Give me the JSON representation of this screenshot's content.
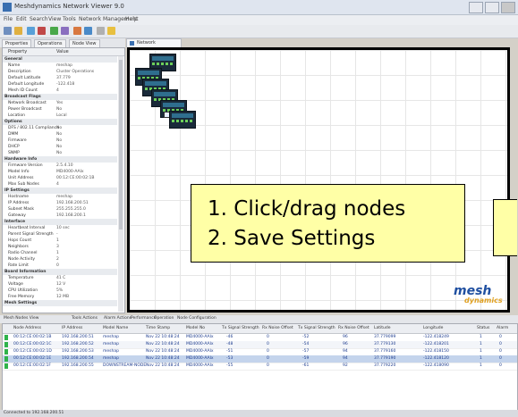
{
  "window": {
    "title": "Meshdynamics Network Viewer 9.0"
  },
  "menu": [
    "File",
    "Edit",
    "Search",
    "View",
    "Tools",
    "Network Management",
    "Help"
  ],
  "left_tabs": [
    "Properties",
    "Operations",
    "Node View"
  ],
  "properties": {
    "header": [
      "Property",
      "Value"
    ],
    "rows": [
      {
        "k": "General",
        "v": "",
        "section": true
      },
      {
        "k": "Name",
        "v": "meshap"
      },
      {
        "k": "Description",
        "v": "Cluster Operations"
      },
      {
        "k": "Default Latitude",
        "v": "37.779"
      },
      {
        "k": "Default Longitude",
        "v": "-122.418"
      },
      {
        "k": "Mesh ID Count",
        "v": "4"
      },
      {
        "k": "Broadcast Flags",
        "v": "",
        "section": true
      },
      {
        "k": "Network Broadcast",
        "v": "Yes"
      },
      {
        "k": "Power Broadcast",
        "v": "No"
      },
      {
        "k": "Location",
        "v": "Local"
      },
      {
        "k": "Options",
        "v": "",
        "section": true
      },
      {
        "k": "DFS / 802.11 Compliance",
        "v": "No"
      },
      {
        "k": "DMM",
        "v": "No"
      },
      {
        "k": "Firmware",
        "v": "No"
      },
      {
        "k": "DHCP",
        "v": "No"
      },
      {
        "k": "SNMP",
        "v": "No"
      },
      {
        "k": "Hardware Info",
        "v": "",
        "section": true
      },
      {
        "k": "Firmware Version",
        "v": "2.5.4.10"
      },
      {
        "k": "Model Info",
        "v": "MD4000-AAIx"
      },
      {
        "k": "Unit Address",
        "v": "00:12:CE:00:02:1B"
      },
      {
        "k": "Max Sub Nodes",
        "v": "4"
      },
      {
        "k": "IP Settings",
        "v": "",
        "section": true
      },
      {
        "k": "Hostname",
        "v": "meshap"
      },
      {
        "k": "IP Address",
        "v": "192.168.200.51"
      },
      {
        "k": "Subnet Mask",
        "v": "255.255.255.0"
      },
      {
        "k": "Gateway",
        "v": "192.168.200.1"
      },
      {
        "k": "Interface",
        "v": "",
        "section": true
      },
      {
        "k": "Heartbeat Interval",
        "v": "10 sec"
      },
      {
        "k": "Parent Signal Strength",
        "v": "-"
      },
      {
        "k": "Hops Count",
        "v": "1"
      },
      {
        "k": "Neighbors",
        "v": "3"
      },
      {
        "k": "Radio Channel",
        "v": "1"
      },
      {
        "k": "Node Activity",
        "v": "2"
      },
      {
        "k": "Rate Limit",
        "v": "0"
      },
      {
        "k": "Board Information",
        "v": "",
        "section": true
      },
      {
        "k": "Temperature",
        "v": "41 C"
      },
      {
        "k": "Voltage",
        "v": "12 V"
      },
      {
        "k": "CPU Utilization",
        "v": "5%"
      },
      {
        "k": "Free Memory",
        "v": "12 MB"
      },
      {
        "k": "Mesh Settings",
        "v": "",
        "section": true
      }
    ]
  },
  "main_tab": "Network",
  "callout": {
    "line1": "1. Click/drag nodes",
    "line2": "2. Save Settings"
  },
  "logo": {
    "top": "mesh",
    "bottom": "dynamics"
  },
  "bottom_tabs": [
    "Mesh Nodes View",
    "Tools Actions",
    "Alarm Actions",
    "Performance",
    "Operation",
    "Node Configuration"
  ],
  "table": {
    "columns": [
      "Node Address",
      "IP Address",
      "Model Name",
      "Time Stamp",
      "Model No",
      "Tx Signal Strength",
      "Rx Noise Offset",
      "Tx Signal Strength",
      "Rx Noise Offset",
      "Latitude",
      "Longitude",
      "Status",
      "Alarm"
    ],
    "rows": [
      [
        "00:12:CE:00:02:1B",
        "192.168.200.51",
        "meshap",
        "Nov 22 10:48:24",
        "MD4000-AAIx",
        "-46",
        "0",
        "-52",
        "96",
        "37.779099",
        "-122.418249",
        "1",
        "0"
      ],
      [
        "00:12:CE:00:02:1C",
        "192.168.200.52",
        "meshap",
        "Nov 22 10:48:24",
        "MD4000-AAIx",
        "-48",
        "0",
        "-54",
        "96",
        "37.779130",
        "-122.418201",
        "1",
        "0"
      ],
      [
        "00:12:CE:00:02:1D",
        "192.168.200.53",
        "meshap",
        "Nov 22 10:48:24",
        "MD4000-AAIx",
        "-51",
        "0",
        "-57",
        "94",
        "37.779160",
        "-122.418150",
        "1",
        "0"
      ],
      [
        "00:12:CE:00:02:1E",
        "192.168.200.54",
        "meshap",
        "Nov 22 10:48:24",
        "MD4000-AAIx",
        "-53",
        "0",
        "-59",
        "94",
        "37.779190",
        "-122.418120",
        "1",
        "0"
      ],
      [
        "00:12:CE:00:02:1F",
        "192.168.200.55",
        "DOWNSTREAM-NODE",
        "Nov 22 10:48:24",
        "MD4000-AAIx",
        "-55",
        "0",
        "-61",
        "92",
        "37.779220",
        "-122.418090",
        "1",
        "0"
      ]
    ]
  },
  "status": {
    "text": "Connected to 192.168.200.51"
  }
}
